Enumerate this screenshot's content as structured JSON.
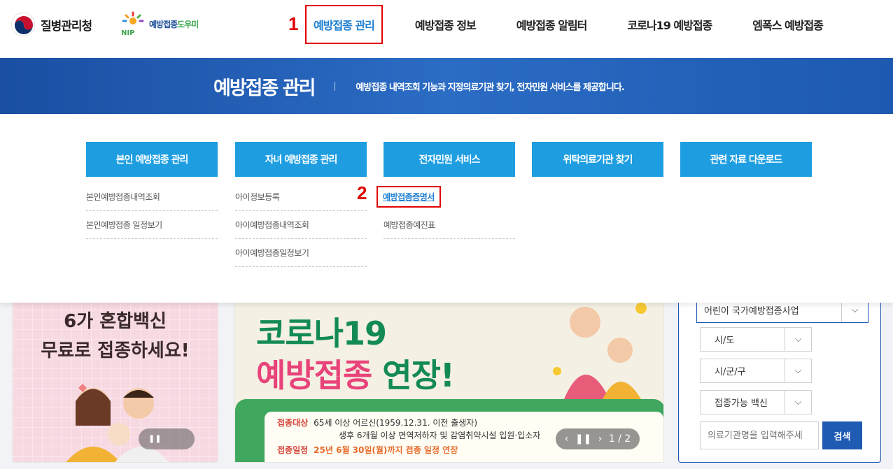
{
  "header": {
    "agency_name": "질병관리청",
    "nip_logo": {
      "text_main": "예방접종",
      "text_accent": "도우미",
      "badge": "NIP"
    },
    "nav": [
      {
        "label": "예방접종 관리"
      },
      {
        "label": "예방접종 정보"
      },
      {
        "label": "예방접종 알림터"
      },
      {
        "label": "코로나19 예방접종"
      },
      {
        "label": "엠폭스 예방접종"
      }
    ],
    "markers": {
      "one": "1",
      "two": "2"
    }
  },
  "banner": {
    "title": "예방접종 관리",
    "description": "예방접종 내역조회 기능과 지정의료기관 찾기, 전자민원 서비스를 제공합니다."
  },
  "mega_menu": {
    "columns": [
      {
        "title": "본인 예방접종 관리",
        "items": [
          "본인예방접종내역조회",
          "본인예방접종 일정보기"
        ]
      },
      {
        "title": "자녀 예방접종 관리",
        "items": [
          "아이정보등록",
          "아이예방접종내역조회",
          "아이예방접종일정보기"
        ]
      },
      {
        "title": "전자민원 서비스",
        "items": [
          "예방접종증명서",
          "예방접종예진표"
        ]
      },
      {
        "title": "위탁의료기관 찾기",
        "items": []
      },
      {
        "title": "관련 자료 다운로드",
        "items": []
      }
    ]
  },
  "background": {
    "left_card": {
      "line1": "6가 혼합백신",
      "line2": "무료로 접종하세요!"
    },
    "mid_card": {
      "line1": "코로나19",
      "line2a": "예방접종",
      "line2b": "연장!",
      "target_label": "접종대상",
      "target_text": "65세 이상 어르신(1959.12.31. 이전 출생자)",
      "target_text2": "생후 6개월 이상 면역저하자 및 감염취약시설 입원·입소자",
      "schedule_label": "접종일정",
      "schedule_text": "25년 6월 30일(월)까지 접종 일정 연장",
      "pager": "1 / 2"
    },
    "search": {
      "program": "어린이 국가예방접종사업",
      "sido": "시/도",
      "sigungu": "시/군/구",
      "vaccine": "접종가능 백신",
      "placeholder": "의료기관명을 입력해주세",
      "button": "검색"
    }
  }
}
